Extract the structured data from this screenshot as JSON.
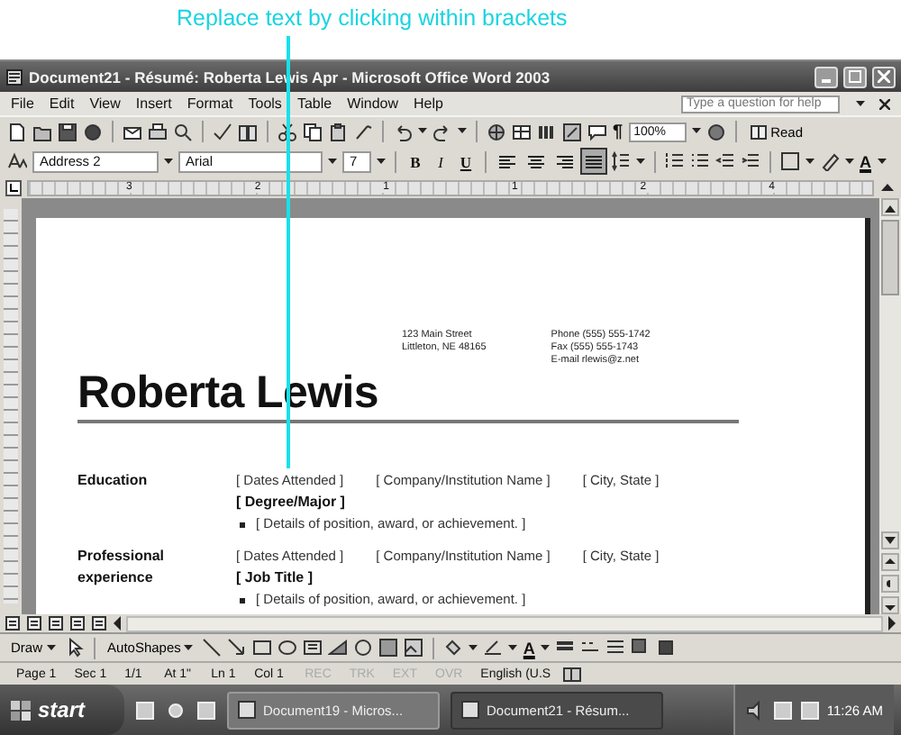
{
  "callout": {
    "text": "Replace text by clicking within brackets"
  },
  "window": {
    "title": "Document21 - Résumé: Roberta Lewis Apr - Microsoft Office Word 2003"
  },
  "menu": [
    "File",
    "Edit",
    "View",
    "Insert",
    "Format",
    "Tools",
    "Table",
    "Window",
    "Help"
  ],
  "help_search": {
    "placeholder": "Type a question for help"
  },
  "standard_toolbar": {
    "pilcrow": "¶",
    "zoom": "100%",
    "read": "Read"
  },
  "formatting_toolbar": {
    "style": "Address 2",
    "font": "Arial",
    "size": "7",
    "text_buttons": [
      "B",
      "I",
      "U"
    ],
    "alignment": [
      {
        "selected": false
      },
      {
        "selected": false
      },
      {
        "selected": false
      },
      {
        "selected": true
      }
    ],
    "font_color": "A"
  },
  "ruler": {
    "labels": [
      "3",
      "2",
      "1",
      "1",
      "2",
      "4"
    ]
  },
  "document": {
    "address": [
      "123 Main Street",
      "Littleton, NE 48165"
    ],
    "contact": [
      "Phone (555) 555-1742",
      "Fax (555) 555-1743",
      "E-mail rlewis@z.net"
    ],
    "name": "Roberta Lewis",
    "sections": [
      {
        "heading": "Education",
        "dates": "[ Dates Attended ]",
        "organization": "[ Company/Institution Name ]",
        "location": "[ City, State ]",
        "title": "[ Degree/Major ]",
        "bullets": [
          "[ Details of position, award, or achievement. ]"
        ]
      },
      {
        "heading": "Professional experience",
        "dates": "[ Dates Attended ]",
        "organization": "[ Company/Institution Name ]",
        "location": "[ City, State ]",
        "title": "[ Job Title ]",
        "bullets": [
          "[ Details of position, award, or achievement. ]"
        ]
      }
    ]
  },
  "draw_toolbar": {
    "draw": "Draw",
    "autoshapes": "AutoShapes",
    "font_color": "A"
  },
  "status_bar": [
    {
      "text": "Page 1",
      "enabled": true
    },
    {
      "text": "Sec 1",
      "enabled": true
    },
    {
      "text": "1/1",
      "enabled": true
    },
    {
      "text": "At 1\"",
      "enabled": true
    },
    {
      "text": "Ln 1",
      "enabled": true
    },
    {
      "text": "Col 1",
      "enabled": true
    },
    {
      "text": "REC",
      "enabled": false
    },
    {
      "text": "TRK",
      "enabled": false
    },
    {
      "text": "EXT",
      "enabled": false
    },
    {
      "text": "OVR",
      "enabled": false
    },
    {
      "text": "English (U.S",
      "enabled": true
    }
  ],
  "taskbar": {
    "start": "start",
    "tasks": [
      {
        "label": "Document19 - Micros...",
        "selected": false
      },
      {
        "label": "Document21 - Résum...",
        "selected": true
      }
    ],
    "clock": "11:26 AM"
  }
}
